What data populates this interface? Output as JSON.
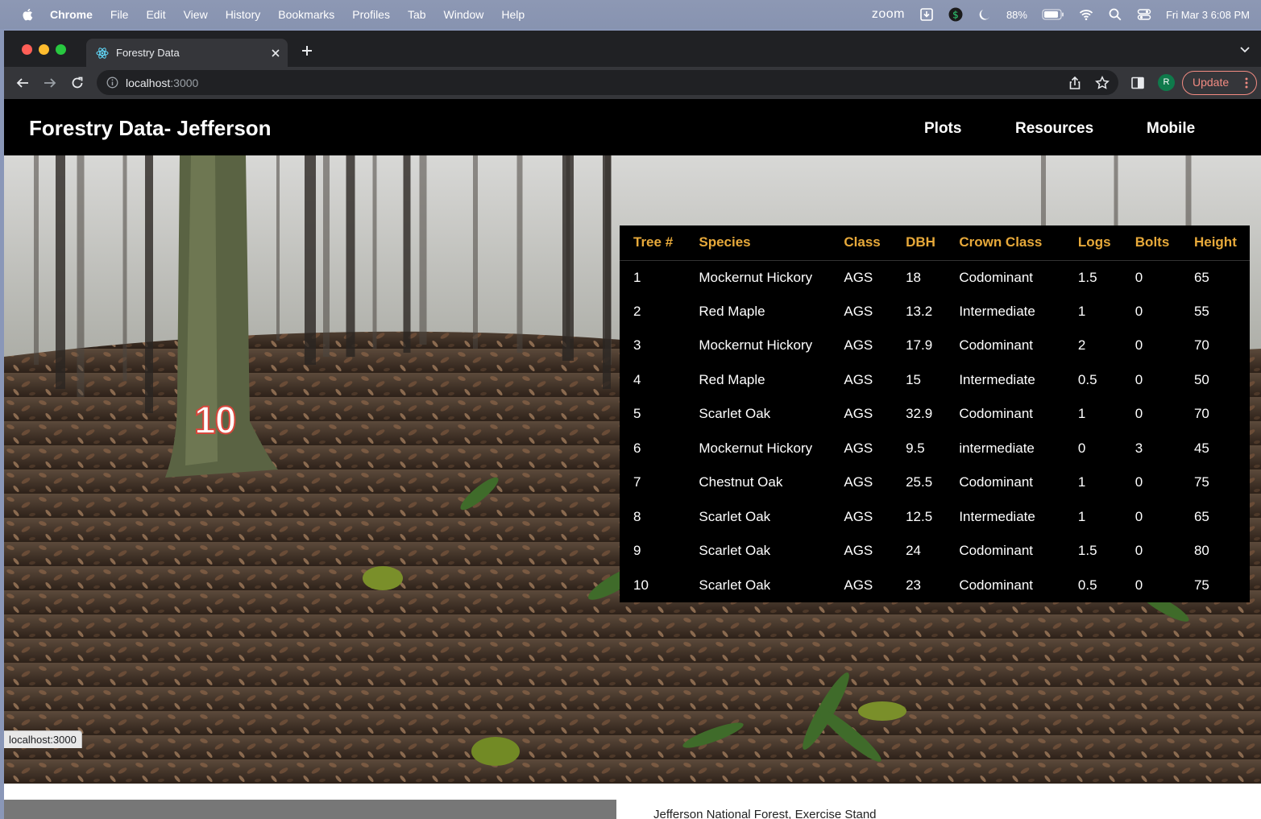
{
  "menubar": {
    "app": "Chrome",
    "items": [
      "File",
      "Edit",
      "View",
      "History",
      "Bookmarks",
      "Profiles",
      "Tab",
      "Window",
      "Help"
    ],
    "status": {
      "zoom": "zoom",
      "battery": "88%",
      "datetime": "Fri Mar 3  6:08 PM"
    }
  },
  "browser": {
    "tab_title": "Forestry Data",
    "url_host": "localhost",
    "url_port": ":3000",
    "profile_initial": "R",
    "update_label": "Update",
    "status_url": "localhost:3000"
  },
  "site": {
    "brand": "Forestry Data- Jefferson",
    "nav": [
      "Plots",
      "Resources",
      "Mobile"
    ]
  },
  "scene": {
    "tree_marker": "10"
  },
  "table": {
    "headers": [
      "Tree #",
      "Species",
      "Class",
      "DBH",
      "Crown Class",
      "Logs",
      "Bolts",
      "Height"
    ],
    "rows": [
      [
        "1",
        "Mockernut Hickory",
        "AGS",
        "18",
        "Codominant",
        "1.5",
        "0",
        "65"
      ],
      [
        "2",
        "Red Maple",
        "AGS",
        "13.2",
        "Intermediate",
        "1",
        "0",
        "55"
      ],
      [
        "3",
        "Mockernut Hickory",
        "AGS",
        "17.9",
        "Codominant",
        "2",
        "0",
        "70"
      ],
      [
        "4",
        "Red Maple",
        "AGS",
        "15",
        "Intermediate",
        "0.5",
        "0",
        "50"
      ],
      [
        "5",
        "Scarlet Oak",
        "AGS",
        "32.9",
        "Codominant",
        "1",
        "0",
        "70"
      ],
      [
        "6",
        "Mockernut Hickory",
        "AGS",
        "9.5",
        "intermediate",
        "0",
        "3",
        "45"
      ],
      [
        "7",
        "Chestnut Oak",
        "AGS",
        "25.5",
        "Codominant",
        "1",
        "0",
        "75"
      ],
      [
        "8",
        "Scarlet Oak",
        "AGS",
        "12.5",
        "Intermediate",
        "1",
        "0",
        "65"
      ],
      [
        "9",
        "Scarlet Oak",
        "AGS",
        "24",
        "Codominant",
        "1.5",
        "0",
        "80"
      ],
      [
        "10",
        "Scarlet Oak",
        "AGS",
        "23",
        "Codominant",
        "0.5",
        "0",
        "75"
      ]
    ]
  },
  "footer": {
    "caption": "Jefferson National Forest, Exercise Stand"
  },
  "colors": {
    "header_text": "#e7a93a",
    "navbar_bg": "#000000",
    "update_accent": "#f28b82"
  }
}
